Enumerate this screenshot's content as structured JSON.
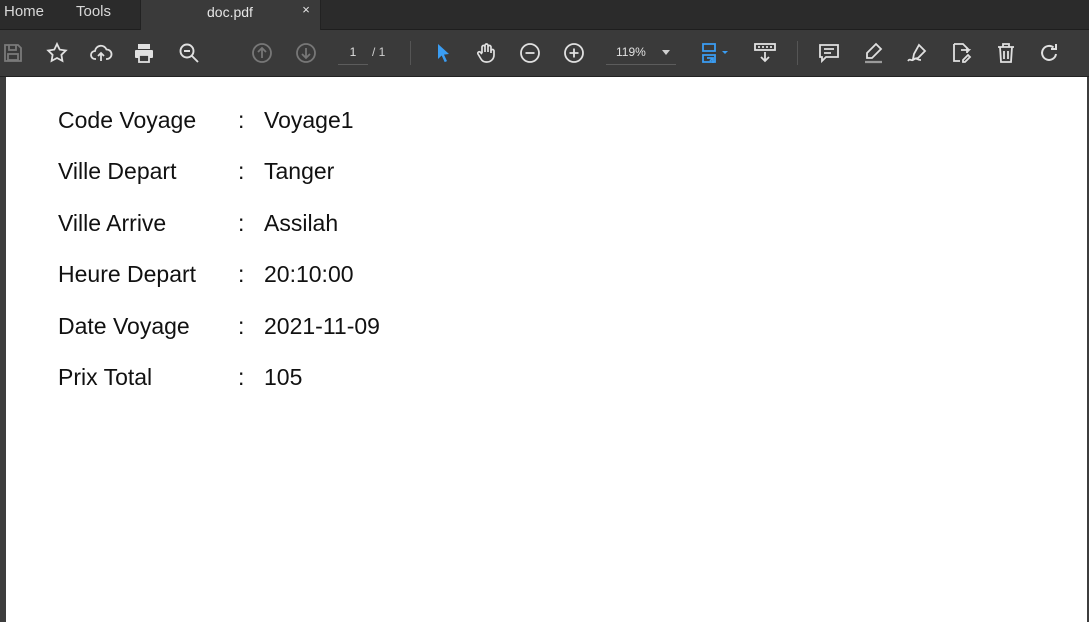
{
  "tabs": {
    "home": "Home",
    "tools": "Tools",
    "document": "doc.pdf",
    "close_glyph": "×"
  },
  "toolbar": {
    "icons": [
      "save-icon",
      "star-icon",
      "upload-cloud-icon",
      "print-icon",
      "zoom-search-icon",
      "page-up-icon",
      "page-down-icon",
      "select-cursor-icon",
      "hand-icon",
      "zoom-out-icon",
      "zoom-in-icon",
      "fit-page-icon",
      "scroll-mode-icon",
      "comment-icon",
      "highlight-icon",
      "sign-icon",
      "edit-doc-icon",
      "delete-icon",
      "rotate-icon"
    ],
    "current_page": "1",
    "page_total": "/ 1",
    "zoom": "119%",
    "accent_color": "#3a9df3"
  },
  "document": {
    "rows": [
      {
        "label": "Code Voyage",
        "colon": ":",
        "value": "Voyage1"
      },
      {
        "label": "Ville Depart",
        "colon": ":",
        "value": "Tanger"
      },
      {
        "label": "Ville Arrive",
        "colon": ":",
        "value": "Assilah"
      },
      {
        "label": "Heure Depart",
        "colon": ":",
        "value": "20:10:00"
      },
      {
        "label": "Date Voyage",
        "colon": ":",
        "value": "2021-11-09"
      },
      {
        "label": "Prix Total",
        "colon": ":",
        "value": "105"
      }
    ]
  }
}
